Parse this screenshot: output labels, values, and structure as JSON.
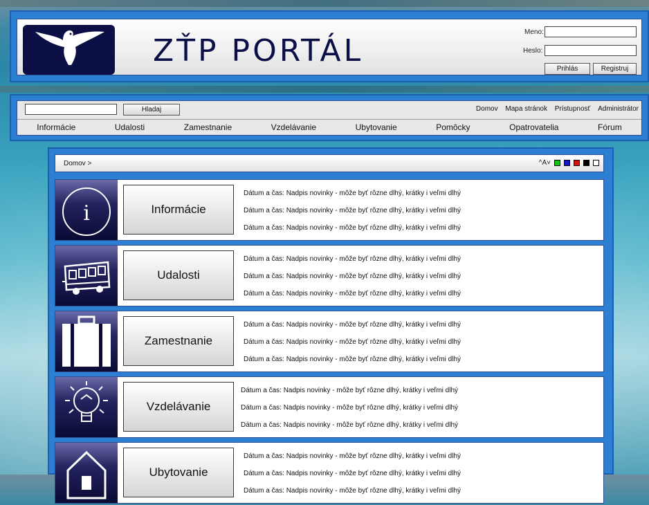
{
  "header": {
    "title": "ZŤP PORTÁL",
    "login": {
      "meno_label": "Meno:",
      "heslo_label": "Heslo:",
      "login_button": "Prihlás",
      "register_button": "Registruj"
    }
  },
  "toolbar": {
    "search_button": "Hladaj",
    "links": [
      "Domov",
      "Mapa stránok",
      "Prístupnosť",
      "Administrátor"
    ]
  },
  "menu": [
    "Informácie",
    "Udalosti",
    "Zamestnanie",
    "Vzdelávanie",
    "Ubytovanie",
    "Pomôcky",
    "Opatrovatelia",
    "Fórum"
  ],
  "breadcrumb": "Domov >",
  "font_size_tool": "^A˅",
  "color_themes": [
    "#14c414",
    "#1414c8",
    "#d01414",
    "#000000",
    "#ffffff"
  ],
  "sections": [
    {
      "label": "Informácie",
      "icon": "info-icon",
      "news": [
        "Dátum a čas: Nadpis novinky - môže byť rôzne dlhý, krátky i veľmi dlhý",
        "Dátum a čas: Nadpis novinky - môže byť rôzne dlhý, krátky i veľmi dlhý",
        "Dátum a čas: Nadpis novinky - môže byť rôzne dlhý, krátky i veľmi dlhý"
      ]
    },
    {
      "label": "Udalosti",
      "icon": "bus-icon",
      "news": [
        "Dátum a čas: Nadpis novinky - môže byť rôzne dlhý, krátky i veľmi dlhý",
        "Dátum a čas: Nadpis novinky - môže byť rôzne dlhý, krátky i veľmi dlhý",
        "Dátum a čas: Nadpis novinky - môže byť rôzne dlhý, krátky i veľmi dlhý"
      ]
    },
    {
      "label": "Zamestnanie",
      "icon": "briefcase-icon",
      "news": [
        "Dátum a čas: Nadpis novinky - môže byť rôzne dlhý, krátky i veľmi dlhý",
        "Dátum a čas: Nadpis novinky - môže byť rôzne dlhý, krátky i veľmi dlhý",
        "Dátum a čas: Nadpis novinky - môže byť rôzne dlhý, krátky i veľmi dlhý"
      ]
    },
    {
      "label": "Vzdelávanie",
      "icon": "lightbulb-icon",
      "news": [
        "Dátum a čas: Nadpis novinky - môže byť rôzne dlhý, krátky i veľmi dlhý",
        "Dátum a čas: Nadpis novinky - môže byť rôzne dlhý, krátky i veľmi dlhý",
        "Dátum a čas: Nadpis novinky - môže byť rôzne dlhý, krátky i veľmi dlhý"
      ]
    },
    {
      "label": "Ubytovanie",
      "icon": "house-icon",
      "news": [
        "Dátum a čas: Nadpis novinky - môže byť rôzne dlhý, krátky i veľmi dlhý",
        "Dátum a čas: Nadpis novinky - môže byť rôzne dlhý, krátky i veľmi dlhý",
        "Dátum a čas: Nadpis novinky - môže byť rôzne dlhý, krátky i veľmi dlhý"
      ]
    }
  ]
}
